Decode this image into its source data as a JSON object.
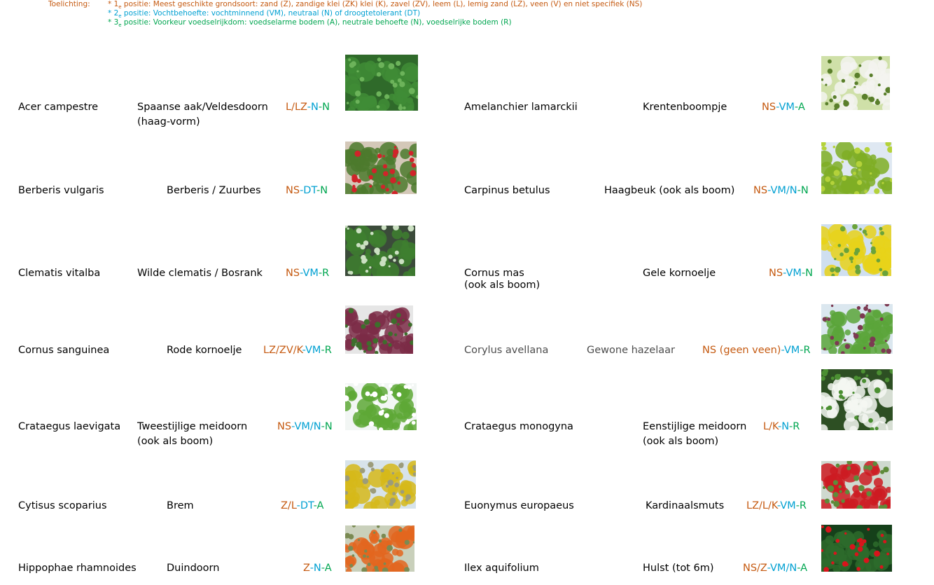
{
  "legend": {
    "label": "Toelichting:",
    "lines": [
      {
        "bullet": "* 1",
        "sub": "e",
        "text": " positie: Meest geschikte grondsoort: zand (Z), zandige klei (ZK) klei (K), zavel (ZV), leem (L), lemig zand (LZ), veen (V) en niet specifiek (NS)",
        "color": "#c55a11"
      },
      {
        "bullet": "* 2",
        "sub": "e",
        "text": " positie: Vochtbehoefte: vochtminnend (VM), neutraal (N) of droogtetolerant (DT)",
        "color": "#00a0d2"
      },
      {
        "bullet": "* 3",
        "sub": "e",
        "text": " positie: Voorkeur voedselrijkdom: voedselarme bodem (A), neutrale behoefte (N), voedselrijke bodem (R)",
        "color": "#00a650"
      }
    ]
  },
  "colors": {
    "soil": "#c55a11",
    "moisture": "#00a0d2",
    "nutrient": "#00a650"
  },
  "plants": [
    {
      "latin": "Acer campestre",
      "common": "Spaanse aak/Veldesdoorn",
      "common2": "(haag-vorm)",
      "soil": "L/LZ",
      "moisture": "N",
      "nutrient": "N",
      "photo": "hedge-leaves-photo"
    },
    {
      "latin": "Amelanchier lamarckii",
      "common": "Krentenboompje",
      "common2": "",
      "soil": "NS",
      "moisture": "VM",
      "nutrient": "A",
      "photo": "white-blossom-tree-photo"
    },
    {
      "latin": "Berberis vulgaris",
      "common": "Berberis / Zuurbes",
      "common2": "",
      "soil": "NS",
      "moisture": "DT",
      "nutrient": "N",
      "photo": "red-berry-shrub-photo"
    },
    {
      "latin": "Carpinus betulus",
      "common": "Haagbeuk (ook als boom)",
      "common2": "",
      "soil": "NS",
      "moisture": "VM/N",
      "nutrient": "N",
      "photo": "hornbeam-hedge-photo"
    },
    {
      "latin": "Clematis vitalba",
      "common": "Wilde clematis / Bosrank",
      "common2": "",
      "soil": "NS",
      "moisture": "VM",
      "nutrient": "R",
      "photo": "clematis-shed-photo"
    },
    {
      "latin": "Cornus mas",
      "latin2": "(ook als boom)",
      "common": "Gele kornoelje",
      "common2": "",
      "soil": "NS",
      "moisture": "VM",
      "nutrient": "N",
      "photo": "yellow-cornel-tree-photo"
    },
    {
      "latin": "Cornus sanguinea",
      "common": "Rode kornoelje",
      "common2": "",
      "soil": "LZ/ZV/K",
      "moisture": "VM",
      "nutrient": "R",
      "photo": "red-dogwood-photo"
    },
    {
      "latin": "Corylus avellana",
      "common": "Gewone hazelaar",
      "common2": "",
      "soil": "NS (geen veen)",
      "moisture": "VM",
      "nutrient": "R",
      "photo": "hazel-garden-photo"
    },
    {
      "latin": "Crataegus laevigata",
      "common": "Tweestijlige meidoorn",
      "common2": "(ook als boom)",
      "soil": "NS",
      "moisture": "VM/N",
      "nutrient": "N",
      "photo": "hawthorn-bush-photo"
    },
    {
      "latin": "Crataegus monogyna",
      "common": "Eenstijlige meidoorn",
      "common2": "(ook als boom)",
      "soil": "L/K",
      "moisture": "N",
      "nutrient": "R",
      "photo": "hawthorn-tree-photo"
    },
    {
      "latin": "Cytisus scoparius",
      "common": "Brem",
      "common2": "",
      "soil": "Z/L",
      "moisture": "DT",
      "nutrient": "A",
      "photo": "broom-shrub-photo"
    },
    {
      "latin": "Euonymus europaeus",
      "common": "Kardinaalsmuts",
      "common2": "",
      "soil": "LZ/L/K",
      "moisture": "VM",
      "nutrient": "R",
      "photo": "spindle-shrub-photo"
    },
    {
      "latin": "Hippophae rhamnoides",
      "common": "Duindoorn",
      "common2": "",
      "soil": "Z",
      "moisture": "N",
      "nutrient": "A",
      "photo": "sea-buckthorn-photo"
    },
    {
      "latin": "Ilex aquifolium",
      "common": "Hulst (tot 6m)",
      "common2": "",
      "soil": "NS/Z",
      "moisture": "VM/N",
      "nutrient": "A",
      "photo": "holly-berries-photo"
    }
  ]
}
